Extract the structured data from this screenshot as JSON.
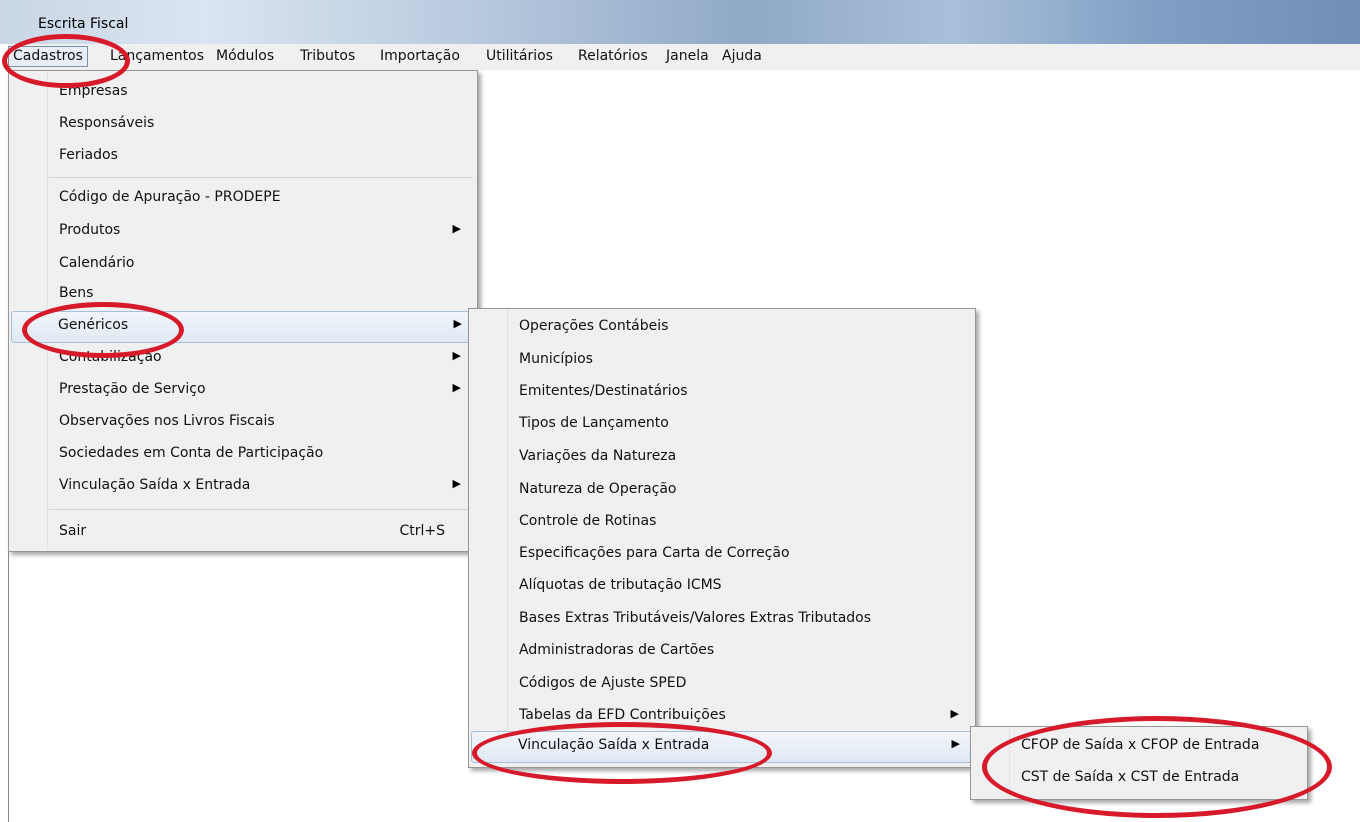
{
  "window": {
    "title": "Escrita Fiscal"
  },
  "menubar": {
    "items": [
      {
        "label": "Cadastros"
      },
      {
        "label": "Lançamentos"
      },
      {
        "label": "Módulos"
      },
      {
        "label": "Tributos"
      },
      {
        "label": "Importação"
      },
      {
        "label": "Utilitários"
      },
      {
        "label": "Relatórios"
      },
      {
        "label": "Janela"
      },
      {
        "label": "Ajuda"
      }
    ]
  },
  "cadastros_menu": {
    "items": [
      {
        "label": "Empresas"
      },
      {
        "label": "Responsáveis"
      },
      {
        "label": "Feriados"
      },
      {
        "label": "Código de Apuração - PRODEPE"
      },
      {
        "label": "Produtos"
      },
      {
        "label": "Calendário"
      },
      {
        "label": "Bens"
      },
      {
        "label": "Genéricos"
      },
      {
        "label": "Contabilização"
      },
      {
        "label": "Prestação de Serviço"
      },
      {
        "label": "Observações nos Livros Fiscais"
      },
      {
        "label": "Sociedades em Conta de Participação"
      },
      {
        "label": "Vinculação Saída x Entrada"
      },
      {
        "label": "Sair",
        "shortcut": "Ctrl+S"
      }
    ]
  },
  "genericos_menu": {
    "items": [
      {
        "label": "Operações Contábeis"
      },
      {
        "label": "Municípios"
      },
      {
        "label": "Emitentes/Destinatários"
      },
      {
        "label": "Tipos de Lançamento"
      },
      {
        "label": "Variações da Natureza"
      },
      {
        "label": "Natureza de Operação"
      },
      {
        "label": "Controle de Rotinas"
      },
      {
        "label": "Especificações para Carta de Correção"
      },
      {
        "label": "Alíquotas de tributação ICMS"
      },
      {
        "label": "Bases Extras Tributáveis/Valores Extras Tributados"
      },
      {
        "label": "Administradoras de Cartões"
      },
      {
        "label": "Códigos de Ajuste SPED"
      },
      {
        "label": "Tabelas da EFD Contribuições"
      },
      {
        "label": "Vinculação Saída x Entrada"
      }
    ]
  },
  "vinculacao_menu": {
    "items": [
      {
        "label": "CFOP de Saída x CFOP de Entrada"
      },
      {
        "label": "CST de Saída x CST de Entrada"
      }
    ]
  },
  "colors": {
    "highlight_annotation": "#d61a2a",
    "menu_bg": "#f0f0f0"
  },
  "icons": {
    "submenu": "submenu-arrow-icon"
  }
}
